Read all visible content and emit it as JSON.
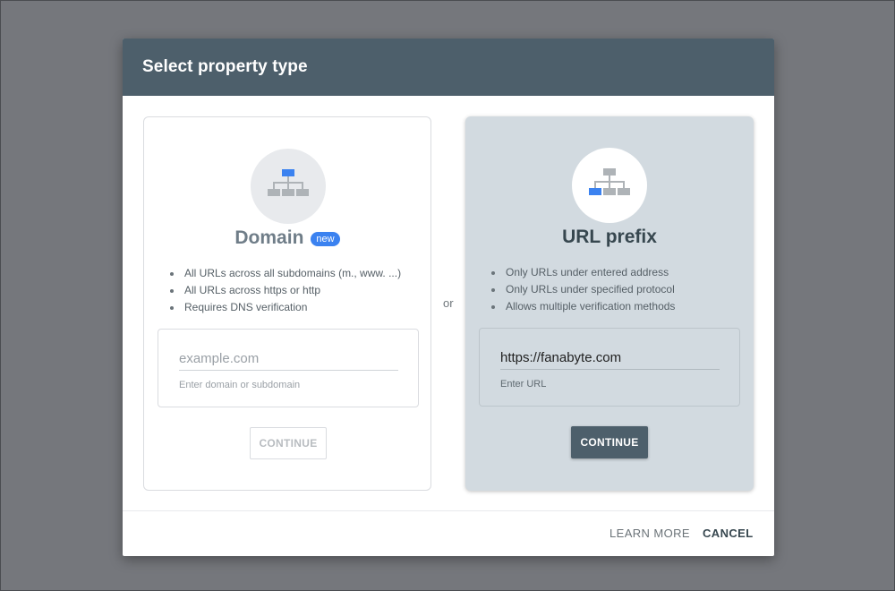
{
  "dialog": {
    "title": "Select property type"
  },
  "domain_card": {
    "title": "Domain",
    "badge": "new",
    "icon": "sitemap-icon",
    "features": [
      "All URLs across all subdomains (m., www. ...)",
      "All URLs across https or http",
      "Requires DNS verification"
    ],
    "input_value": "",
    "input_placeholder": "example.com",
    "input_hint": "Enter domain or subdomain",
    "button_label": "CONTINUE"
  },
  "separator": "or",
  "url_card": {
    "title": "URL prefix",
    "icon": "sitemap-icon",
    "features": [
      "Only URLs under entered address",
      "Only URLs under specified protocol",
      "Allows multiple verification methods"
    ],
    "input_value": "https://fanabyte.com",
    "input_placeholder": "",
    "input_hint": "Enter URL",
    "button_label": "CONTINUE"
  },
  "footer": {
    "learn_more_label": "LEARN MORE",
    "cancel_label": "CANCEL"
  },
  "colors": {
    "header_bg": "#4d5f6b",
    "accent_blue": "#3b82f0",
    "selected_card_bg": "#d2dae0",
    "node_gray": "#aeb3b7"
  }
}
